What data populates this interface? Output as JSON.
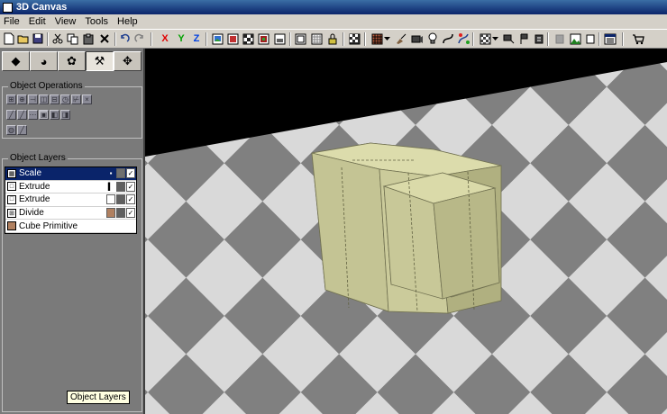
{
  "window": {
    "title": "3D Canvas"
  },
  "menu": [
    "File",
    "Edit",
    "View",
    "Tools",
    "Help"
  ],
  "toolbar": {
    "axis_x": "X",
    "axis_y": "Y",
    "axis_z": "Z"
  },
  "left_panel": {
    "tabs": [
      "nav-icon",
      "globe-icon",
      "objects-icon",
      "tools-icon",
      "move-icon"
    ],
    "object_operations_label": "Object Operations",
    "object_layers_label": "Object Layers",
    "layers": [
      {
        "label": "Scale",
        "selected": true
      },
      {
        "label": "Extrude",
        "selected": false
      },
      {
        "label": "Extrude",
        "selected": false
      },
      {
        "label": "Divide",
        "selected": false
      },
      {
        "label": "Cube Primitive",
        "selected": false
      }
    ],
    "tooltip": "Object Layers"
  },
  "colors": {
    "cube": "#c8c896",
    "floor_light": "#d9d9d9",
    "floor_dark": "#808080",
    "selection": "#0a246a"
  }
}
